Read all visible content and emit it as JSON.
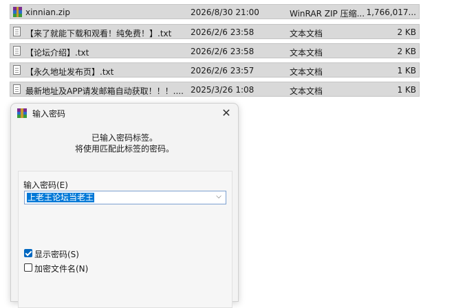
{
  "files": [
    {
      "name": "xinnian.zip",
      "date": "2026/8/30 21:00",
      "type": "WinRAR ZIP 压缩...",
      "size": "1,766,017...",
      "icon": "winrar-archive-icon"
    },
    {
      "name": "【来了就能下载和观看！纯免费！】.txt",
      "date": "2026/2/6 23:58",
      "type": "文本文档",
      "size": "2 KB",
      "icon": "text-file-icon"
    },
    {
      "name": "【论坛介绍】.txt",
      "date": "2026/2/6 23:58",
      "type": "文本文档",
      "size": "2 KB",
      "icon": "text-file-icon"
    },
    {
      "name": "【永久地址发布页】.txt",
      "date": "2026/2/6 23:57",
      "type": "文本文档",
      "size": "1 KB",
      "icon": "text-file-icon"
    },
    {
      "name": "最新地址及APP请发邮箱自动获取！！！....",
      "date": "2025/3/26 1:08",
      "type": "文本文档",
      "size": "1 KB",
      "icon": "text-file-icon"
    }
  ],
  "dialog": {
    "title": "输入密码",
    "close_glyph": "✕",
    "info_line1": "已输入密码标签。",
    "info_line2": "将使用匹配此标签的密码。",
    "password_label": "输入密码(E)",
    "password_value": "上老王论坛当老王",
    "dropdown_glyph": "⌵",
    "show_password_label": "显示密码(S)",
    "show_password_checked": true,
    "encrypt_names_label": "加密文件名(N)",
    "encrypt_names_checked": false
  },
  "colors": {
    "selection": "#0078d7",
    "checkbox_on": "#0067c0",
    "row_background": "#d9d9d9"
  }
}
